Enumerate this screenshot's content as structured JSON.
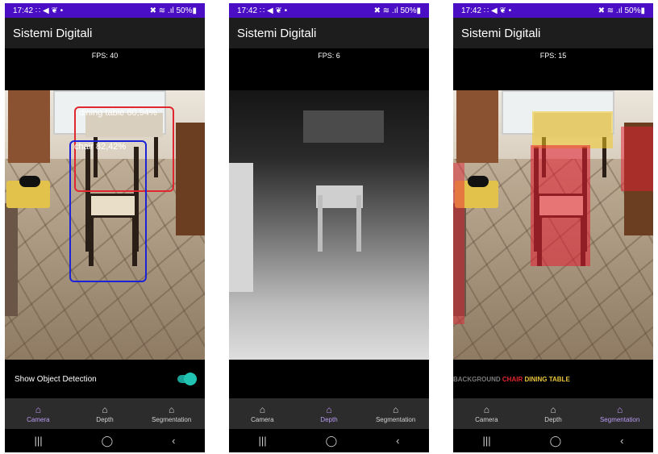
{
  "status_bar": {
    "time": "17:42",
    "icons": "∷ ◀ ❦ •",
    "right": "✖ ≋ .ıl 50%▮"
  },
  "app_title": "Sistemi Digitali",
  "screens": [
    {
      "fps": "FPS: 40",
      "mode": "detection"
    },
    {
      "fps": "FPS: 6",
      "mode": "depth"
    },
    {
      "fps": "FPS: 15",
      "mode": "segmentation"
    }
  ],
  "detections": [
    {
      "label": "dining table 60,94%",
      "color": "#e0262e"
    },
    {
      "label": "chair 82,42%",
      "color": "#1c22d6"
    }
  ],
  "toggle": {
    "label": "Show Object Detection",
    "on": true
  },
  "segmentation_legend": [
    {
      "label": "BACKGROUND",
      "color": "#7a7a7a"
    },
    {
      "label": "CHAIR",
      "color": "#e0262e"
    },
    {
      "label": "DINING TABLE",
      "color": "#e7c43c"
    }
  ],
  "nav": [
    {
      "label": "Camera",
      "icon": "home-icon"
    },
    {
      "label": "Depth",
      "icon": "home-icon"
    },
    {
      "label": "Segmentation",
      "icon": "home-icon"
    }
  ],
  "active_nav": [
    "Camera",
    "Depth",
    "Segmentation"
  ],
  "system_nav": {
    "recents": "|||",
    "home": "◯",
    "back": "‹"
  }
}
